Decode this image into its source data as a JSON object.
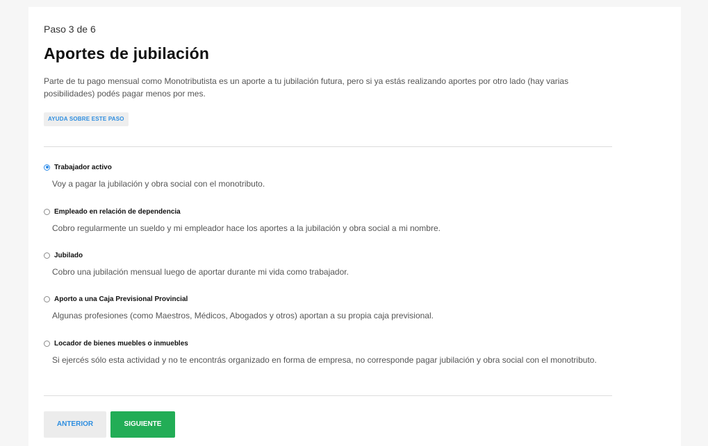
{
  "header": {
    "step": "Paso 3 de 6",
    "title": "Aportes de jubilación",
    "description": "Parte de tu pago mensual como Monotributista es un aporte a tu jubilación futura, pero si ya estás realizando aportes por otro lado (hay varias posibilidades) podés pagar menos por mes.",
    "help_label": "AYUDA SOBRE ESTE PASO"
  },
  "options": [
    {
      "label": "Trabajador activo",
      "description": "Voy a pagar la jubilación y obra social con el monotributo.",
      "selected": true
    },
    {
      "label": "Empleado en relación de dependencia",
      "description": "Cobro regularmente un sueldo y mi empleador hace los aportes a la jubilación y obra social a mi nombre.",
      "selected": false
    },
    {
      "label": "Jubilado",
      "description": "Cobro una jubilación mensual luego de aportar durante mi vida como trabajador.",
      "selected": false
    },
    {
      "label": "Aporto a una Caja Previsional Provincial",
      "description": "Algunas profesiones (como Maestros, Médicos, Abogados y otros) aportan a su propia caja previsional.",
      "selected": false
    },
    {
      "label": "Locador de bienes muebles o inmuebles",
      "description": "Si ejercés sólo esta actividad y no te encontrás organizado en forma de empresa, no corresponde pagar jubilación y obra social con el monotributo.",
      "selected": false
    }
  ],
  "buttons": {
    "prev": "ANTERIOR",
    "next": "SIGUIENTE"
  },
  "colors": {
    "accent": "#2a8ae8",
    "primary_button": "#22ad56",
    "link": "#2e8ee0"
  }
}
